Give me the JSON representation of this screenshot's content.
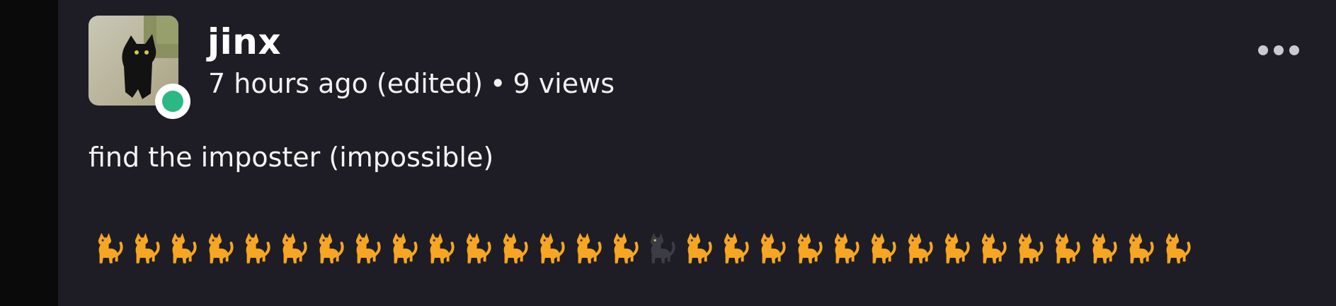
{
  "post": {
    "author": "jinx",
    "time": "7 hours ago (edited)",
    "separator": "•",
    "views": "9 views",
    "content_text": "find the imposter (impossible)",
    "cat_row": {
      "count": 30,
      "imposter_index": 15,
      "cat_emoji": "🐈",
      "imposter_emoji": "🐈‍⬛"
    }
  },
  "icons": {
    "more": "more-options-icon",
    "status": "online-status-icon",
    "avatar": "black-cat-avatar"
  },
  "colors": {
    "background": "#1e1d26",
    "online": "#2bb884",
    "cat_orange": "#f6a623",
    "cat_black": "#3c3c44"
  }
}
